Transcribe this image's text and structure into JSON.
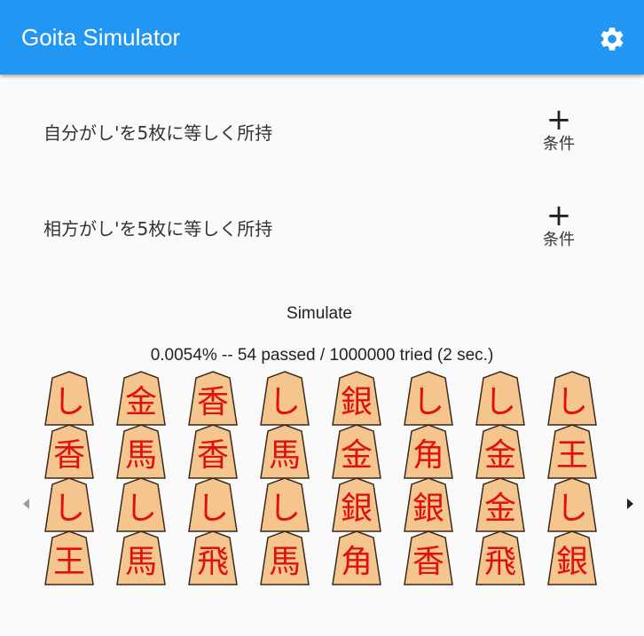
{
  "appbar": {
    "title": "Goita Simulator",
    "settings_icon": "gear-icon"
  },
  "conditions": [
    {
      "text": "自分がし'を5枚に等しく所持",
      "add_icon": "plus-icon",
      "add_label": "条件"
    },
    {
      "text": "相方がし'を5枚に等しく所持",
      "add_icon": "plus-icon",
      "add_label": "条件"
    }
  ],
  "simulate": {
    "label": "Simulate"
  },
  "result": {
    "text": "0.0054% -- 54 passed / 1000000 tried (2 sec.)"
  },
  "pieces": [
    [
      "し",
      "金",
      "香",
      "し",
      "銀",
      "し",
      "し",
      "し"
    ],
    [
      "香",
      "馬",
      "香",
      "馬",
      "金",
      "角",
      "金",
      "王"
    ],
    [
      "し",
      "し",
      "し",
      "し",
      "銀",
      "銀",
      "金",
      "し"
    ],
    [
      "王",
      "馬",
      "飛",
      "馬",
      "角",
      "香",
      "飛",
      "銀"
    ]
  ],
  "nav": {
    "prev_icon": "chevron-left-icon",
    "next_icon": "chevron-right-icon"
  },
  "colors": {
    "appbar": "#2196f3",
    "piece_fill": "#f5c58f",
    "piece_text": "#e01010"
  }
}
